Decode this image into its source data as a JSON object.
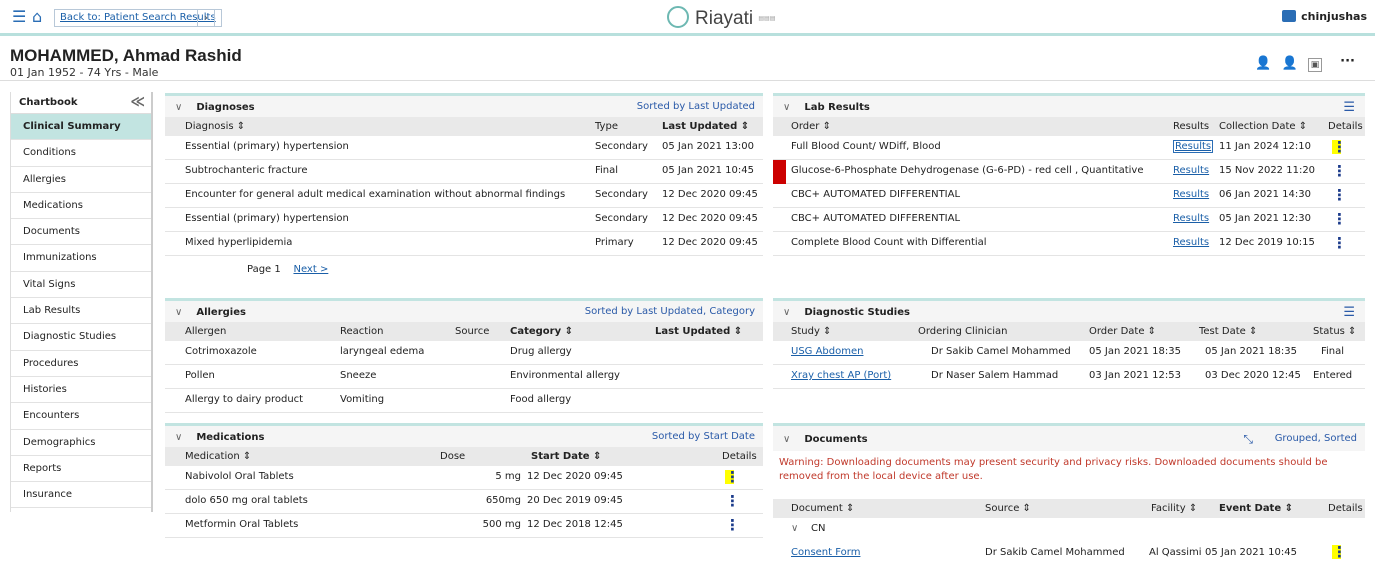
{
  "topbar": {
    "back_label": "Back to: Patient Search Results",
    "back_arrow": "›",
    "logo_text": "Riayati",
    "logo_sub": "▤▤▤",
    "user": "chinjushas"
  },
  "patient": {
    "name": "MOHAMMED, Ahmad Rashid",
    "info": "01 Jan 1952 - 74 Yrs - Male",
    "more": "···"
  },
  "sidebar": {
    "title": "Chartbook",
    "collapse": "≪",
    "items": [
      "Clinical Summary",
      "Conditions",
      "Allergies",
      "Medications",
      "Documents",
      "Immunizations",
      "Vital Signs",
      "Lab Results",
      "Diagnostic Studies",
      "Procedures",
      "Histories",
      "Encounters",
      "Demographics",
      "Reports",
      "Insurance"
    ]
  },
  "diagnoses": {
    "title": "Diagnoses",
    "sort": "Sorted by Last Updated",
    "headers": [
      "Diagnosis ⇕",
      "Type",
      "Last Updated ⇕"
    ],
    "rows": [
      [
        "Essential (primary) hypertension",
        "Secondary",
        "05 Jan 2021 13:00"
      ],
      [
        "Subtrochanteric fracture",
        "Final",
        "05 Jan 2021 10:45"
      ],
      [
        "Encounter for general adult medical examination without abnormal findings",
        "Secondary",
        "12 Dec 2020 09:45"
      ],
      [
        "Essential (primary) hypertension",
        "Secondary",
        "12 Dec 2020 09:45"
      ],
      [
        "Mixed hyperlipidemia",
        "Primary",
        "12 Dec 2020 09:45"
      ]
    ],
    "page": "Page 1",
    "next": "Next >"
  },
  "allergies": {
    "title": "Allergies",
    "sort": "Sorted by Last Updated, Category",
    "headers": [
      "Allergen",
      "Reaction",
      "Source",
      "Category ⇕",
      "Last Updated ⇕"
    ],
    "rows": [
      [
        "Cotrimoxazole",
        "laryngeal edema",
        "",
        "Drug allergy",
        ""
      ],
      [
        "Pollen",
        "Sneeze",
        "",
        "Environmental allergy",
        ""
      ],
      [
        "Allergy to dairy product",
        "Vomiting",
        "",
        "Food allergy",
        ""
      ]
    ]
  },
  "medications": {
    "title": "Medications",
    "sort": "Sorted by Start Date",
    "headers": [
      "Medication ⇕",
      "Dose",
      "Start Date ⇕",
      "Details"
    ],
    "rows": [
      [
        "Nabivolol Oral Tablets",
        "5 mg",
        "12 Dec 2020 09:45"
      ],
      [
        "dolo 650 mg oral tablets",
        "650mg",
        "20 Dec 2019 09:45"
      ],
      [
        "Metformin Oral Tablets",
        "500 mg",
        "12 Dec 2018 12:45"
      ]
    ]
  },
  "labs": {
    "title": "Lab Results",
    "headers": [
      "Order ⇕",
      "Results",
      "Collection Date ⇕",
      "Details"
    ],
    "rows": [
      [
        "Full Blood Count/ WDiff, Blood",
        "Results",
        "11 Jan 2024 12:10"
      ],
      [
        "Glucose-6-Phosphate Dehydrogenase (G-6-PD) - red cell , Quantitative",
        "Results",
        "15 Nov 2022 11:20"
      ],
      [
        "CBC+ AUTOMATED DIFFERENTIAL",
        "Results",
        "06 Jan 2021 14:30"
      ],
      [
        "CBC+ AUTOMATED DIFFERENTIAL",
        "Results",
        "05 Jan 2021 12:30"
      ],
      [
        "Complete Blood Count with Differential",
        "Results",
        "12 Dec 2019 10:15"
      ]
    ]
  },
  "studies": {
    "title": "Diagnostic Studies",
    "headers": [
      "Study ⇕",
      "Ordering Clinician",
      "Order Date ⇕",
      "Test Date ⇕",
      "Status ⇕"
    ],
    "rows": [
      [
        "USG Abdomen",
        "Dr Sakib Camel Mohammed",
        "05 Jan 2021 18:35",
        "05 Jan 2021 18:35",
        "Final"
      ],
      [
        "Xray chest AP (Port)",
        "Dr Naser Salem Hammad",
        "03 Jan 2021 12:53",
        "03 Dec 2020 12:45",
        "Entered"
      ]
    ]
  },
  "documents": {
    "title": "Documents",
    "sort": "Grouped, Sorted",
    "warning": "Warning: Downloading documents may present security and privacy risks. Downloaded documents should be removed from the local device after use.",
    "headers": [
      "Document ⇕",
      "Source ⇕",
      "Facility ⇕",
      "Event Date ⇕",
      "Details"
    ],
    "group": "CN",
    "rows": [
      [
        "Consent Form",
        "Dr Sakib Camel Mohammed",
        "Al Qassimi",
        "05 Jan 2021 10:45"
      ]
    ]
  },
  "colors": {
    "accent": "#c2e4e1",
    "link": "#1a5fa8",
    "highlight": "#ffff00",
    "alert": "#cc0000"
  }
}
